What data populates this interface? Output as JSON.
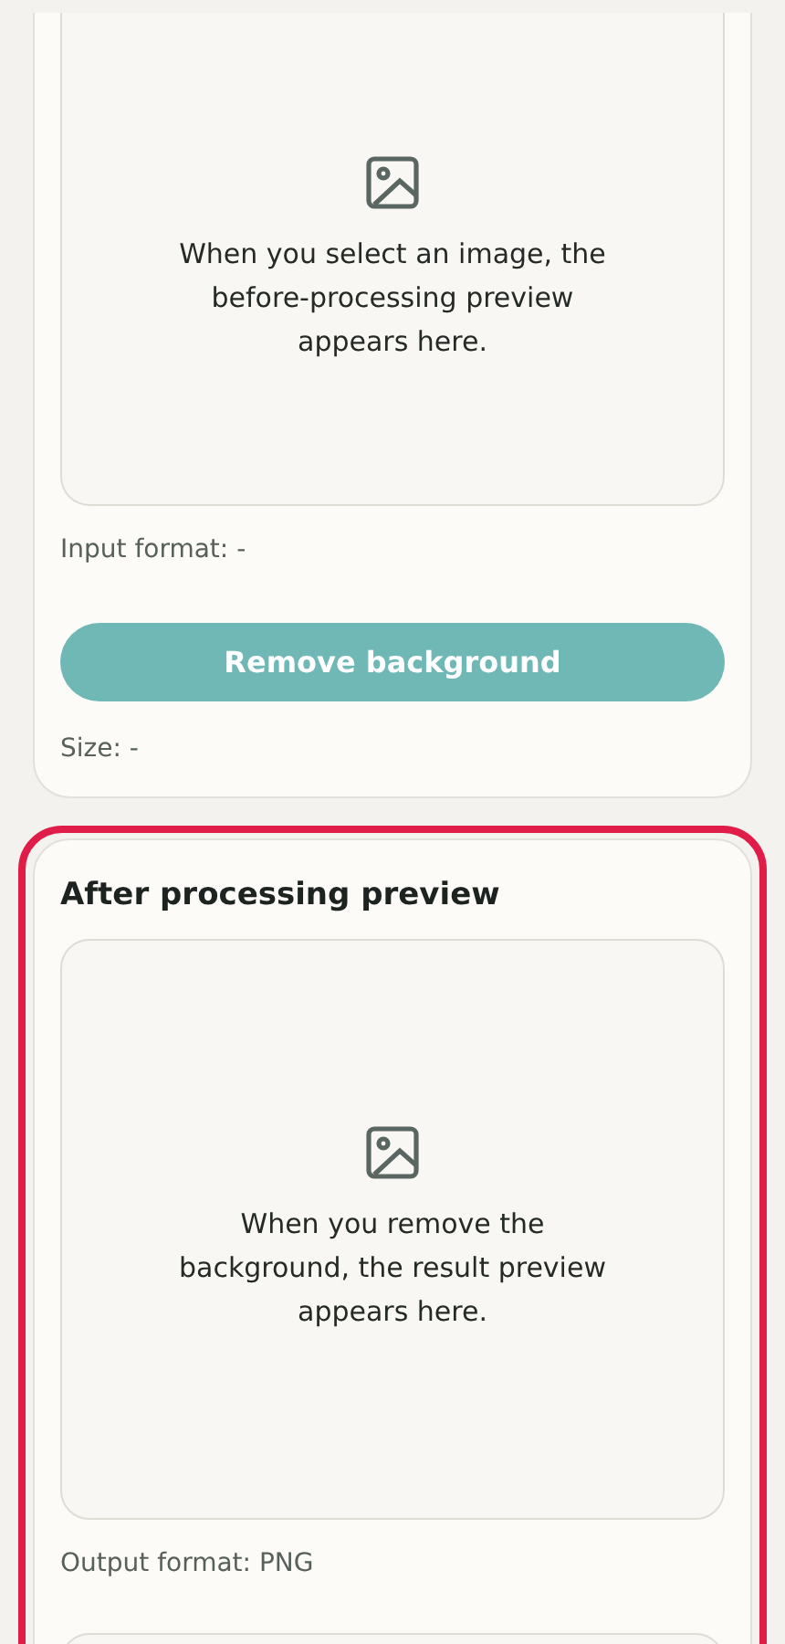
{
  "cards": [
    {
      "highlighted": false,
      "preview_text": "When you select an image, the before-processing preview appears here.",
      "format": "Input format: -",
      "button": "Remove background",
      "size": "Size: -"
    },
    {
      "highlighted": true,
      "title": "After processing preview",
      "preview_text": "When you remove the background, the result preview appears here.",
      "format": "Output format: PNG"
    }
  ]
}
